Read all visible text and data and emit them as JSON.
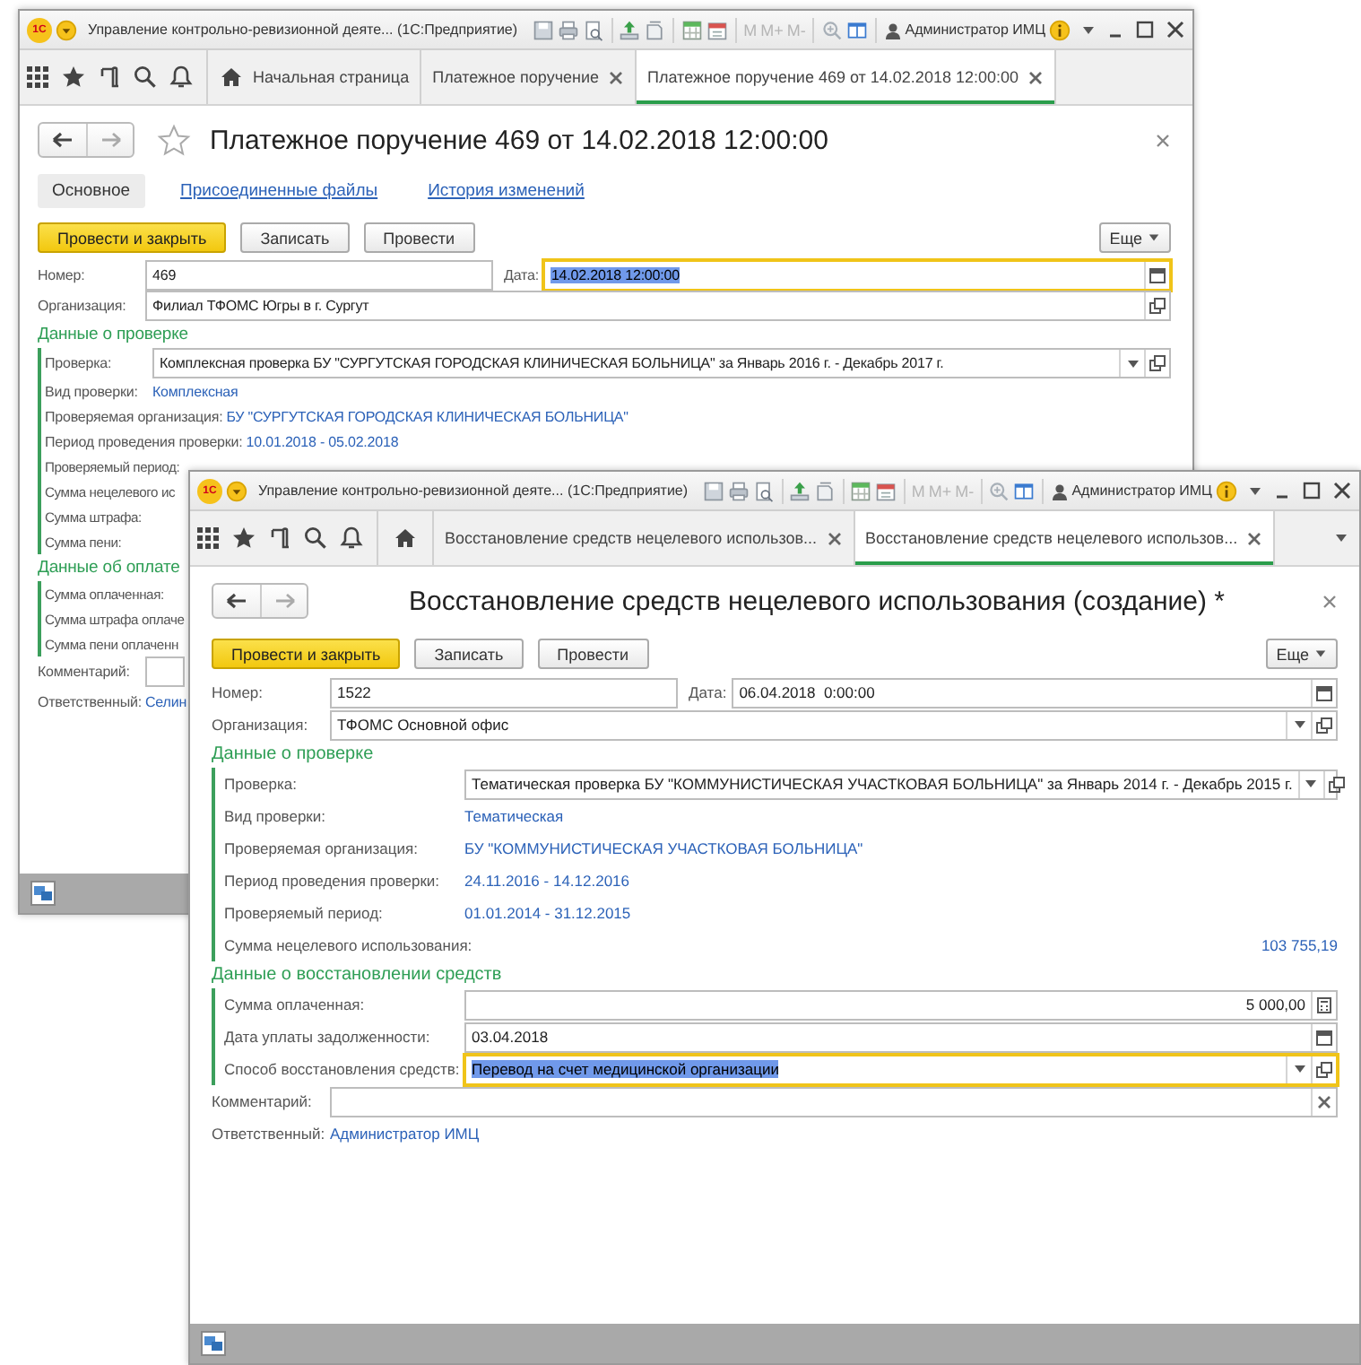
{
  "windows": [
    {
      "logo": "1С",
      "title": "Управление контрольно-ревизионной деяте... (1С:Предприятие)",
      "memory_buttons": [
        "M",
        "M+",
        "M-"
      ],
      "user": "Администратор ИМЦ",
      "tabs": [
        {
          "kind": "home",
          "label": "Начальная страница",
          "selected": false
        },
        {
          "kind": "doc",
          "label": "Платежное поручение",
          "selected": false
        },
        {
          "kind": "doc",
          "label": "Платежное поручение 469 от 14.02.2018 12:00:00",
          "selected": true
        }
      ],
      "tab_menu": false,
      "form": {
        "title": "Платежное поручение 469 от 14.02.2018 12:00:00",
        "star": true,
        "subtabs": [
          {
            "label": "Основное",
            "selected": true
          },
          {
            "label": "Присоединенные файлы",
            "selected": false
          },
          {
            "label": "История изменений",
            "selected": false
          }
        ],
        "buttons": [
          {
            "label": "Провести и закрыть",
            "kind": "primary"
          },
          {
            "label": "Записать",
            "kind": "normal"
          },
          {
            "label": "Провести",
            "kind": "normal"
          }
        ],
        "more": "Еще",
        "rows": [
          {
            "kind": "number_date",
            "label": "Номер:",
            "value": "469",
            "date_label": "Дата:",
            "date_value": "14.02.2018 12:00:00",
            "date_focused": true
          },
          {
            "kind": "ref",
            "label": "Организация:",
            "value": "Филиал ТФОМС Югры в г. Сургут",
            "focused": false
          },
          {
            "kind": "section",
            "title": "Данные о проверке",
            "rows": [
              {
                "kind": "select",
                "label": "Проверка:",
                "value": "Комплексная проверка БУ \"СУРГУТСКАЯ ГОРОДСКАЯ КЛИНИЧЕСКАЯ БОЛЬНИЦА\" за Январь 2016 г. - Декабрь 2017 г.",
                "focused": false
              },
              {
                "kind": "link",
                "label": "Вид проверки:",
                "value": "Комплексная"
              },
              {
                "kind": "link",
                "label": "Проверяемая организация:",
                "value": "БУ \"СУРГУТСКАЯ ГОРОДСКАЯ КЛИНИЧЕСКАЯ БОЛЬНИЦА\""
              },
              {
                "kind": "link",
                "label": "Период проведения проверки:",
                "value": "10.01.2018 - 05.02.2018"
              },
              {
                "kind": "label",
                "label": "Проверяемый период:"
              },
              {
                "kind": "label",
                "label": "Сумма нецелевого ис"
              },
              {
                "kind": "label",
                "label": "Сумма штрафа:"
              },
              {
                "kind": "label",
                "label": "Сумма пени:"
              }
            ]
          },
          {
            "kind": "section",
            "title": "Данные об оплате",
            "rows": [
              {
                "kind": "label",
                "label": "Сумма оплаченная:"
              },
              {
                "kind": "label",
                "label": "Сумма штрафа оплаче"
              },
              {
                "kind": "label",
                "label": "Сумма пени оплаченн"
              }
            ]
          },
          {
            "kind": "stub",
            "label": "Комментарий:"
          },
          {
            "kind": "link",
            "label": "Ответственный:",
            "value": "Селин"
          }
        ]
      }
    },
    {
      "logo": "1С",
      "title": "Управление контрольно-ревизионной деяте... (1С:Предприятие)",
      "memory_buttons": [
        "M",
        "M+",
        "M-"
      ],
      "user": "Администратор ИМЦ",
      "tabs": [
        {
          "kind": "home",
          "selected": false
        },
        {
          "kind": "doc",
          "label": "Восстановление средств нецелевого использов...",
          "selected": false
        },
        {
          "kind": "doc",
          "label": "Восстановление средств нецелевого использов...",
          "selected": true
        }
      ],
      "tab_menu": true,
      "form": {
        "title": "Восстановление средств нецелевого использования (создание) *",
        "star": false,
        "buttons": [
          {
            "label": "Провести и закрыть",
            "kind": "primary"
          },
          {
            "label": "Записать",
            "kind": "normal"
          },
          {
            "label": "Провести",
            "kind": "normal"
          }
        ],
        "more": "Еще",
        "rows": [
          {
            "kind": "number_date",
            "label": "Номер:",
            "value": "1522",
            "date_label": "Дата:",
            "date_value": "06.04.2018  0:00:00",
            "date_focused": false
          },
          {
            "kind": "select",
            "label": "Организация:",
            "value": "ТФОМС Основной офис",
            "focused": false
          },
          {
            "kind": "section",
            "title": "Данные о проверке",
            "rows": [
              {
                "kind": "select",
                "label": "Проверка:",
                "value": "Тематическая проверка БУ \"КОММУНИСТИЧЕСКАЯ УЧАСТКОВАЯ БОЛЬНИЦА\" за Январь 2014 г. - Декабрь 2015 г.",
                "focused": false
              },
              {
                "kind": "link",
                "label": "Вид проверки:",
                "value": "Тематическая"
              },
              {
                "kind": "link",
                "label": "Проверяемая организация:",
                "value": "БУ \"КОММУНИСТИЧЕСКАЯ УЧАСТКОВАЯ БОЛЬНИЦА\""
              },
              {
                "kind": "link",
                "label": "Период проведения проверки:",
                "value": "24.11.2016 - 14.12.2016"
              },
              {
                "kind": "link",
                "label": "Проверяемый период:",
                "value": "01.01.2014 - 31.12.2015"
              },
              {
                "kind": "amount",
                "label": "Сумма нецелевого использования:",
                "value": "103 755,19"
              }
            ]
          },
          {
            "kind": "section",
            "title": "Данные о восстановлении средств",
            "rows": [
              {
                "kind": "number",
                "label": "Сумма оплаченная:",
                "value": "5 000,00",
                "focused": false
              },
              {
                "kind": "date",
                "label": "Дата уплаты задолженности:",
                "value": "03.04.2018",
                "focused": false
              },
              {
                "kind": "select",
                "label": "Способ восстановления средств:",
                "value": "Перевод на счет медицинской организации",
                "focused": true
              }
            ]
          },
          {
            "kind": "comment",
            "label": "Комментарий:"
          },
          {
            "kind": "link",
            "label": "Ответственный:",
            "value": "Администратор ИМЦ"
          }
        ]
      }
    }
  ]
}
